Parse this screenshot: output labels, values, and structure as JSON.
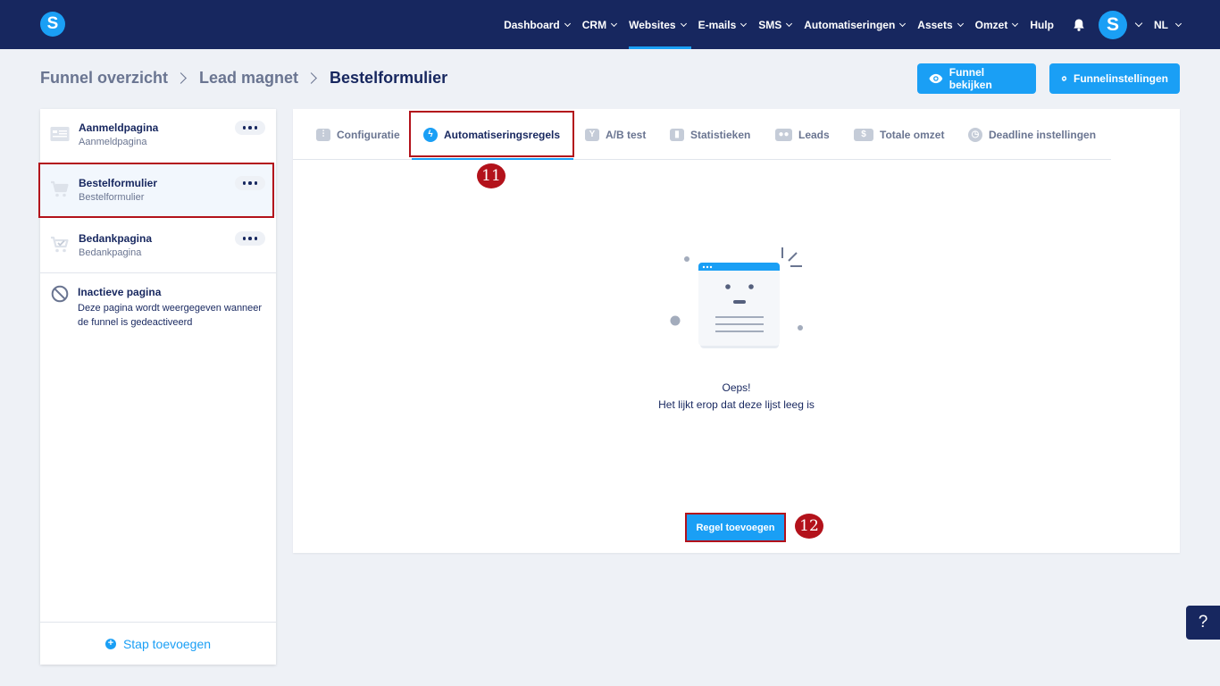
{
  "brand": {
    "logo_letter": "S",
    "accent": "#1a9ff5",
    "nav_bg": "#17275f",
    "highlight": "#b3121b"
  },
  "nav": {
    "items": [
      {
        "label": "Dashboard"
      },
      {
        "label": "CRM"
      },
      {
        "label": "Websites"
      },
      {
        "label": "E-mails"
      },
      {
        "label": "SMS"
      },
      {
        "label": "Automatiseringen"
      },
      {
        "label": "Assets"
      },
      {
        "label": "Omzet"
      }
    ],
    "help_label": "Hulp",
    "avatar_letter": "S",
    "language": "NL"
  },
  "breadcrumb": {
    "items": [
      "Funnel overzicht",
      "Lead magnet",
      "Bestelformulier"
    ]
  },
  "actions": {
    "view_funnel": "Funnel bekijken",
    "funnel_settings": "Funnelinstellingen"
  },
  "sidebar": {
    "pages": [
      {
        "title": "Aanmeldpagina",
        "subtitle": "Aanmeldpagina",
        "icon": "landing-page-icon"
      },
      {
        "title": "Bestelformulier",
        "subtitle": "Bestelformulier",
        "icon": "cart-icon"
      },
      {
        "title": "Bedankpagina",
        "subtitle": "Bedankpagina",
        "icon": "cart-check-icon"
      }
    ],
    "inactive": {
      "title": "Inactieve pagina",
      "description": "Deze pagina wordt weergegeven wanneer de funnel is gedeactiveerd"
    },
    "add_step": "Stap toevoegen"
  },
  "tabs": [
    {
      "label": "Configuratie",
      "icon": "sliders-icon"
    },
    {
      "label": "Automatiseringsregels",
      "icon": "lightning-icon"
    },
    {
      "label": "A/B test",
      "icon": "split-icon"
    },
    {
      "label": "Statistieken",
      "icon": "bar-chart-icon"
    },
    {
      "label": "Leads",
      "icon": "users-icon"
    },
    {
      "label": "Totale omzet",
      "icon": "dollar-icon"
    },
    {
      "label": "Deadline instellingen",
      "icon": "clock-icon"
    }
  ],
  "empty_state": {
    "title": "Oeps!",
    "message": "Het lijkt erop dat deze lijst leeg is"
  },
  "add_rule_button": "Regel toevoegen",
  "annotations": {
    "tab_marker": "11",
    "button_marker": "12"
  },
  "help_button": "?"
}
